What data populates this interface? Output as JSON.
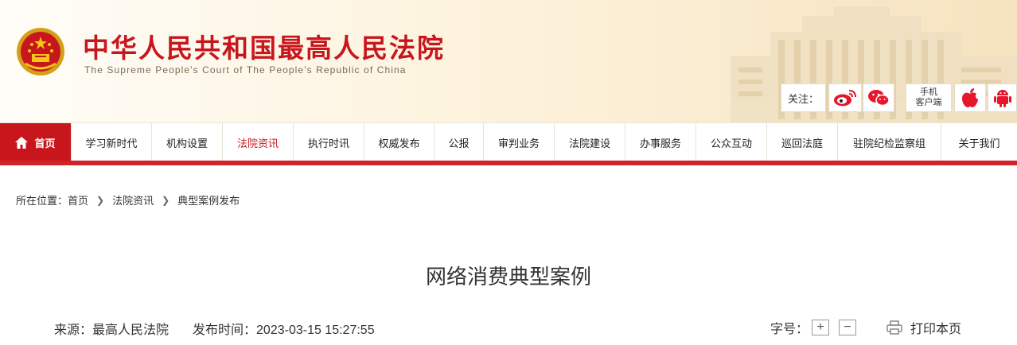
{
  "header": {
    "title_cn": "中华人民共和国最高人民法院",
    "title_en": "The Supreme People's Court of The People's Republic of China",
    "follow_label": "关注：",
    "mobile_label_line1": "手机",
    "mobile_label_line2": "客户端",
    "social_icons": [
      "weibo-icon",
      "wechat-icon",
      "apple-icon",
      "android-icon"
    ],
    "brand_color": "#c8161d"
  },
  "nav": {
    "items": [
      {
        "label": "首页"
      },
      {
        "label": "学习新时代"
      },
      {
        "label": "机构设置"
      },
      {
        "label": "法院资讯"
      },
      {
        "label": "执行时讯"
      },
      {
        "label": "权威发布"
      },
      {
        "label": "公报"
      },
      {
        "label": "审判业务"
      },
      {
        "label": "法院建设"
      },
      {
        "label": "办事服务"
      },
      {
        "label": "公众互动"
      },
      {
        "label": "巡回法庭"
      },
      {
        "label": "驻院纪检监察组"
      },
      {
        "label": "关于我们"
      }
    ],
    "active_index": 3
  },
  "breadcrumb": {
    "prefix": "所在位置：",
    "items": [
      "首页",
      "法院资讯",
      "典型案例发布"
    ]
  },
  "article": {
    "title": "网络消费典型案例",
    "source": "来源：最高人民法院",
    "publish_time": "发布时间：2023-03-15 15:27:55"
  },
  "tools": {
    "font_size_label": "字号：",
    "increase": "+",
    "decrease": "−",
    "print_label": "打印本页"
  }
}
